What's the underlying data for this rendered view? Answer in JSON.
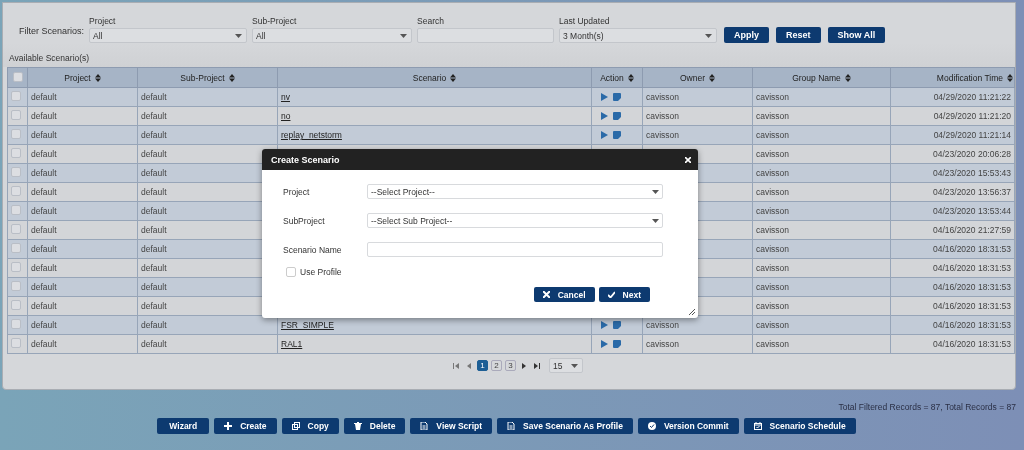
{
  "filters": {
    "label": "Filter Scenarios:",
    "fields": [
      {
        "kind": "select",
        "label": "Project",
        "value": "All"
      },
      {
        "kind": "select",
        "label": "Sub-Project",
        "value": "All"
      },
      {
        "kind": "text",
        "label": "Search"
      },
      {
        "kind": "select",
        "label": "Last Updated",
        "value": "3 Month(s)"
      }
    ],
    "buttons": [
      "Apply",
      "Reset",
      "Show All"
    ]
  },
  "table": {
    "title": "Available Scenario(s)",
    "header_checked": false,
    "columns": [
      "Project",
      "Sub-Project",
      "Scenario",
      "Action",
      "Owner",
      "Group Name",
      "Modification Time"
    ],
    "rows": [
      {
        "checked": false,
        "project": "default",
        "sub_project": "default",
        "scenario": "nv",
        "actions": true,
        "owner": "cavisson",
        "group": "cavisson",
        "time": "04/29/2020 11:21:22"
      },
      {
        "checked": false,
        "project": "default",
        "sub_project": "default",
        "scenario": "no",
        "actions": true,
        "owner": "cavisson",
        "group": "cavisson",
        "time": "04/29/2020 11:21:20"
      },
      {
        "checked": false,
        "project": "default",
        "sub_project": "default",
        "scenario": "replay_netstorm",
        "actions": true,
        "owner": "cavisson",
        "group": "cavisson",
        "time": "04/29/2020 11:21:14"
      },
      {
        "checked": false,
        "project": "default",
        "sub_project": "default",
        "actions": false,
        "group": "cavisson",
        "time": "04/23/2020 20:06:28"
      },
      {
        "checked": false,
        "project": "default",
        "sub_project": "default",
        "actions": false,
        "group": "cavisson",
        "time": "04/23/2020 15:53:43"
      },
      {
        "checked": false,
        "project": "default",
        "sub_project": "default",
        "actions": false,
        "group": "cavisson",
        "time": "04/23/2020 13:56:37"
      },
      {
        "checked": false,
        "project": "default",
        "sub_project": "default",
        "actions": false,
        "group": "cavisson",
        "time": "04/23/2020 13:53:44"
      },
      {
        "checked": false,
        "project": "default",
        "sub_project": "default",
        "actions": false,
        "group": "cavisson",
        "time": "04/16/2020 21:27:59"
      },
      {
        "checked": false,
        "project": "default",
        "sub_project": "default",
        "actions": false,
        "group": "cavisson",
        "time": "04/16/2020 18:31:53"
      },
      {
        "checked": false,
        "project": "default",
        "sub_project": "default",
        "actions": false,
        "group": "cavisson",
        "time": "04/16/2020 18:31:53"
      },
      {
        "checked": false,
        "project": "default",
        "sub_project": "default",
        "actions": false,
        "group": "cavisson",
        "time": "04/16/2020 18:31:53"
      },
      {
        "checked": false,
        "project": "default",
        "sub_project": "default",
        "actions": false,
        "group": "cavisson",
        "time": "04/16/2020 18:31:53"
      },
      {
        "checked": false,
        "project": "default",
        "sub_project": "default",
        "scenario": "FSR_SIMPLE",
        "actions": true,
        "owner": "cavisson",
        "group": "cavisson",
        "time": "04/16/2020 18:31:53"
      },
      {
        "checked": false,
        "project": "default",
        "sub_project": "default",
        "scenario": "RAL1",
        "actions": true,
        "owner": "cavisson",
        "group": "cavisson",
        "time": "04/16/2020 18:31:53"
      }
    ]
  },
  "pager": {
    "pages": [
      {
        "label": "1",
        "selected": true
      },
      {
        "label": "2",
        "selected": false
      },
      {
        "label": "3",
        "selected": false
      }
    ],
    "page_size": "15"
  },
  "footer": {
    "totals": "Total Filtered Records = 87, Total Records = 87",
    "buttons": [
      "Wizard",
      "Create",
      "Copy",
      "Delete",
      "View Script",
      "Save Scenario As Profile",
      "Version Commit",
      "Scenario Schedule"
    ]
  },
  "dialog": {
    "title": "Create Scenario",
    "fields": [
      {
        "kind": "select",
        "label": "Project",
        "value": "--Select Project--"
      },
      {
        "kind": "select",
        "label": "SubProject",
        "value": "--Select Sub Project--"
      },
      {
        "kind": "text",
        "label": "Scenario Name"
      }
    ],
    "checkbox": {
      "label": "Use Profile",
      "checked": false
    },
    "buttons": [
      "Cancel",
      "Next"
    ]
  }
}
